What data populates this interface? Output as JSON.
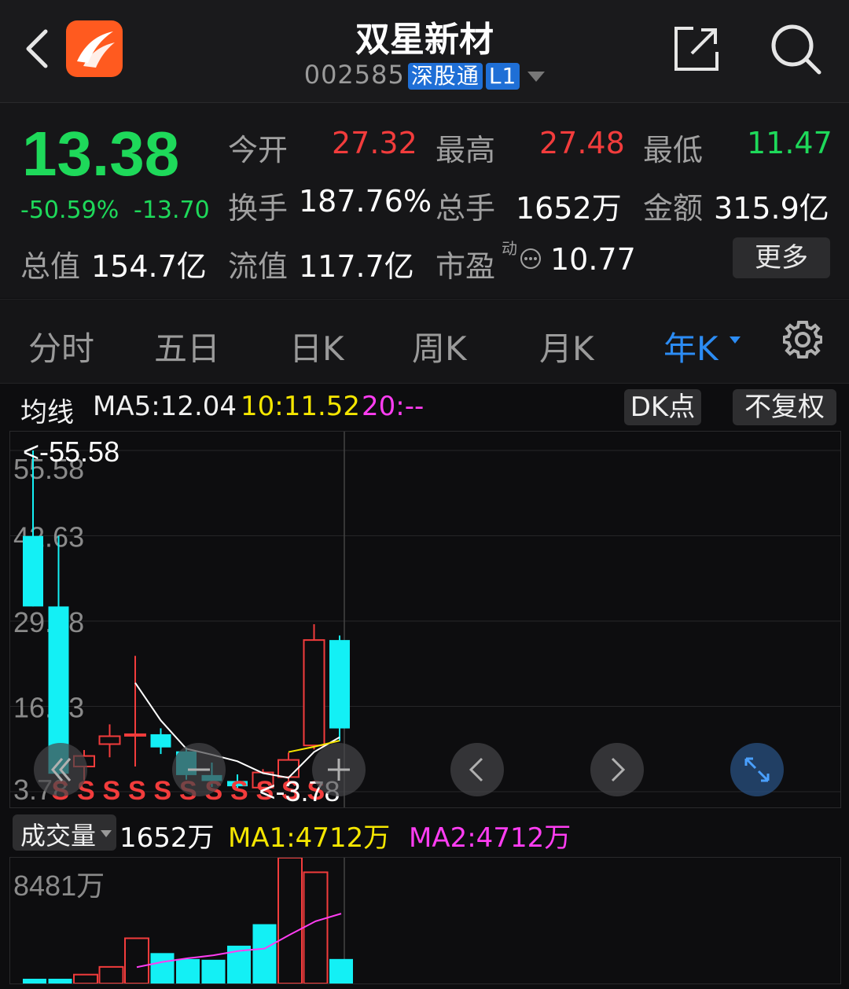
{
  "header": {
    "title": "双星新材",
    "code": "002585",
    "tag1": "深股通",
    "tag2": "L1"
  },
  "quote": {
    "price": "13.38",
    "change_pct": "-50.59%",
    "change_abs": "-13.70",
    "open_label": "今开",
    "open": "27.32",
    "high_label": "最高",
    "high": "27.48",
    "low_label": "最低",
    "low": "11.47",
    "turnover_label": "换手",
    "turnover": "187.76%",
    "volume_label": "总手",
    "volume": "1652万",
    "amount_label": "金额",
    "amount": "315.9亿",
    "mktcap_label": "总值",
    "mktcap": "154.7亿",
    "float_label": "流值",
    "float": "117.7亿",
    "pe_label": "市盈",
    "pe_sup": "动",
    "pe": "10.77",
    "more_label": "更多"
  },
  "tabs": [
    {
      "label": "分时"
    },
    {
      "label": "五日"
    },
    {
      "label": "日K"
    },
    {
      "label": "周K"
    },
    {
      "label": "月K"
    },
    {
      "label": "年K"
    }
  ],
  "active_tab": "年K",
  "ma_bar": {
    "label": "均线",
    "ma5": "MA5:12.04",
    "ma10": "10:11.52",
    "ma20": "20:--",
    "dk_label": "DK点",
    "adj_label": "不复权"
  },
  "kline": {
    "ylabels": [
      "55.58",
      "42.63",
      "29.68",
      "16.73",
      "3.78"
    ],
    "max_marker": "<-55.58",
    "min_marker": "<-3.78",
    "signal_char": "S",
    "ylim": [
      3.78,
      55.58
    ],
    "candles": [
      {
        "o": 42.6,
        "c": 31.9,
        "h": 55.58,
        "l": 31.9
      },
      {
        "o": 31.9,
        "c": 6.5,
        "h": 42.6,
        "l": 5.8
      },
      {
        "o": 7.6,
        "c": 9.2,
        "h": 10.1,
        "l": 5.5
      },
      {
        "o": 11.0,
        "c": 12.2,
        "h": 14.0,
        "l": 9.0
      },
      {
        "o": 12.3,
        "c": 12.5,
        "h": 24.4,
        "l": 7.6
      },
      {
        "o": 12.5,
        "c": 10.5,
        "h": 13.4,
        "l": 9.5
      },
      {
        "o": 9.9,
        "c": 6.3,
        "h": 10.5,
        "l": 5.6
      },
      {
        "o": 6.3,
        "c": 5.4,
        "h": 8.2,
        "l": 4.5
      },
      {
        "o": 5.4,
        "c": 4.6,
        "h": 6.4,
        "l": 4.1
      },
      {
        "o": 4.4,
        "c": 6.7,
        "h": 7.2,
        "l": 3.78
      },
      {
        "o": 6.0,
        "c": 8.6,
        "h": 9.7,
        "l": 5.0
      },
      {
        "o": 10.8,
        "c": 26.8,
        "h": 29.2,
        "l": 10.2
      },
      {
        "o": 26.8,
        "c": 13.38,
        "h": 27.48,
        "l": 11.47
      }
    ],
    "ma5_line": [
      null,
      null,
      null,
      null,
      20.3,
      14.6,
      10.3,
      9.4,
      8.4,
      6.6,
      5.9,
      9.8,
      12.04
    ],
    "ma10_line": [
      null,
      null,
      null,
      null,
      null,
      null,
      null,
      null,
      null,
      null,
      9.8,
      10.6,
      11.52
    ]
  },
  "volume": {
    "label": "成交量",
    "current": "1652万",
    "ma1": "MA1:4712万",
    "ma2": "MA2:4712万",
    "ylabel": "8481万",
    "ymax": 8481,
    "bars": [
      {
        "v": 320,
        "up": false
      },
      {
        "v": 320,
        "up": false
      },
      {
        "v": 600,
        "up": true
      },
      {
        "v": 1120,
        "up": true
      },
      {
        "v": 3050,
        "up": true
      },
      {
        "v": 2050,
        "up": false
      },
      {
        "v": 1650,
        "up": false
      },
      {
        "v": 1600,
        "up": false
      },
      {
        "v": 2550,
        "up": false
      },
      {
        "v": 4000,
        "up": false
      },
      {
        "v": 8481,
        "up": true
      },
      {
        "v": 7500,
        "up": true
      },
      {
        "v": 1652,
        "up": false
      }
    ],
    "ma_line": [
      null,
      null,
      null,
      null,
      1100,
      1450,
      1700,
      1900,
      2200,
      2350,
      3300,
      4200,
      4712
    ]
  },
  "colors": {
    "up": "#f23c3c",
    "down": "#13f0f5",
    "ma5": "#ffffff",
    "ma10": "#f5e600",
    "ma20": "#ff3df2",
    "accent": "#2c8cf4"
  }
}
